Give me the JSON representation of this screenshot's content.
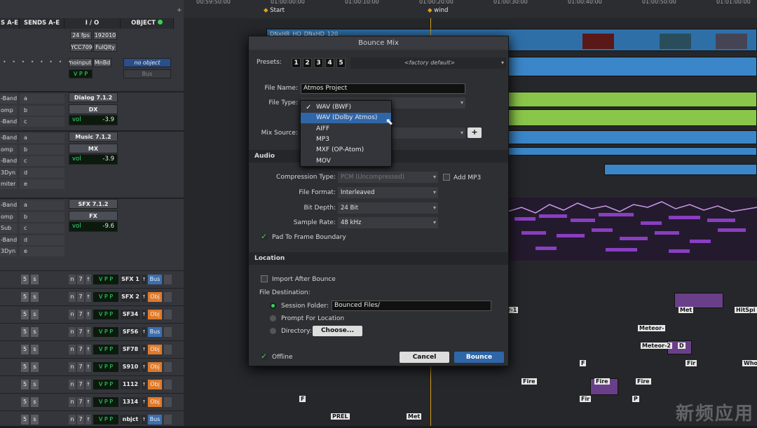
{
  "mix_header": {
    "sends_ae": "S A-E",
    "sends_ae2": "SENDS A-E",
    "io": "I / O",
    "object": "OBJECT"
  },
  "top_io": {
    "fps": "24 fps",
    "res": "192010",
    "color": "YCC709",
    "quality": "FulQlty",
    "input": "noinput",
    "mnbd": "MnBd",
    "no_object": "no object",
    "bus": "Bus",
    "vp": "V P P"
  },
  "groups": [
    {
      "slots": [
        "-Band",
        "omp",
        "-Band"
      ],
      "sends": [
        "a",
        "b",
        "c"
      ],
      "out": "Dialog 7.1.2",
      "fx": "DX",
      "vol_label": "vol",
      "vol": "-3.9"
    },
    {
      "slots": [
        "-Band",
        "omp",
        "-Band",
        "3Dyn",
        "miter"
      ],
      "sends": [
        "a",
        "b",
        "c",
        "d",
        "e"
      ],
      "out": "Music 7.1.2",
      "fx": "MX",
      "vol_label": "vol",
      "vol": "-3.9"
    },
    {
      "slots": [
        "-Band",
        "omp",
        "Sub",
        "-Band",
        "3Dyn"
      ],
      "sends": [
        "a",
        "b",
        "c",
        "d",
        "e"
      ],
      "out": "SFX 7.1.2",
      "fx": "FX",
      "vol_label": "vol",
      "vol": "-9.6"
    }
  ],
  "tracks": [
    {
      "name": "SFX 1",
      "obj": "Bus"
    },
    {
      "name": "SFX 2",
      "obj": "Obj"
    },
    {
      "name": "SF34",
      "obj": "Obj"
    },
    {
      "name": "SF56",
      "obj": "Bus"
    },
    {
      "name": "SF78",
      "obj": "Obj"
    },
    {
      "name": "S910",
      "obj": "Obj"
    },
    {
      "name": "1112",
      "obj": "Obj"
    },
    {
      "name": "1314",
      "obj": "Obj"
    },
    {
      "name": "nbjct",
      "obj": "Bus"
    }
  ],
  "track_btns": {
    "five": "5",
    "s": "s",
    "n": "n",
    "seven": "7",
    "vp": "V P",
    "vpp": "V P P"
  },
  "ruler": {
    "times": [
      "00:59:50:00",
      "01:00:00:00",
      "01:00:10:00",
      "01:00:20:00",
      "01:00:30:00",
      "01:00:40:00",
      "01:00:50:00",
      "01:01:00:00"
    ],
    "plus": "+",
    "marker1": "Start",
    "marker2": "wind"
  },
  "clips": {
    "video": "DNxHR_HQ_DNxHD_120",
    "labels": [
      "or-1",
      "Met",
      "HitSpi",
      "Meteor-",
      "Meteor-2",
      "D",
      "F",
      "Fir",
      "Who",
      "Fire",
      "Fire",
      "Fire",
      "F",
      "Fir",
      "P",
      "PREL",
      "Met"
    ]
  },
  "dialog": {
    "title": "Bounce Mix",
    "presets_label": "Presets:",
    "preset_nums": [
      "1",
      "2",
      "3",
      "4",
      "5"
    ],
    "preset_value": "<factory default>",
    "file_name_label": "File Name:",
    "file_name": "Atmos Project",
    "file_type_label": "File Type:",
    "mix_source_label": "Mix Source:",
    "add_btn": "+",
    "audio_section": "Audio",
    "compression_label": "Compression Type:",
    "compression_value": "PCM (Uncompressed)",
    "add_mp3": "Add MP3",
    "file_format_label": "File Format:",
    "file_format": "Interleaved",
    "bit_depth_label": "Bit Depth:",
    "bit_depth": "24 Bit",
    "sample_rate_label": "Sample Rate:",
    "sample_rate": "48 kHz",
    "pad_frame": "Pad To Frame Boundary",
    "location_section": "Location",
    "import_after": "Import After Bounce",
    "file_dest_label": "File Destination:",
    "session_folder_label": "Session Folder:",
    "session_folder": "Bounced Files/",
    "prompt_location": "Prompt For Location",
    "directory_label": "Directory:",
    "choose_btn": "Choose...",
    "offline": "Offline",
    "cancel": "Cancel",
    "bounce": "Bounce"
  },
  "file_type_menu": {
    "check": "✓",
    "items": [
      "WAV (BWF)",
      "WAV (Dolby Atmos)",
      "AIFF",
      "MP3",
      "MXF (OP-Atom)",
      "MOV"
    ],
    "selected_index": 1
  },
  "watermark": "新频应用",
  "colors": {
    "accent": "#2f66a8",
    "green": "#36d45a",
    "dialog_clip": "#8ac64a",
    "music_clip": "#3a86c8",
    "sfx_purple": "#8a3ec2",
    "obj_orange": "#e07a2a",
    "bus_blue": "#3b6fb0"
  }
}
